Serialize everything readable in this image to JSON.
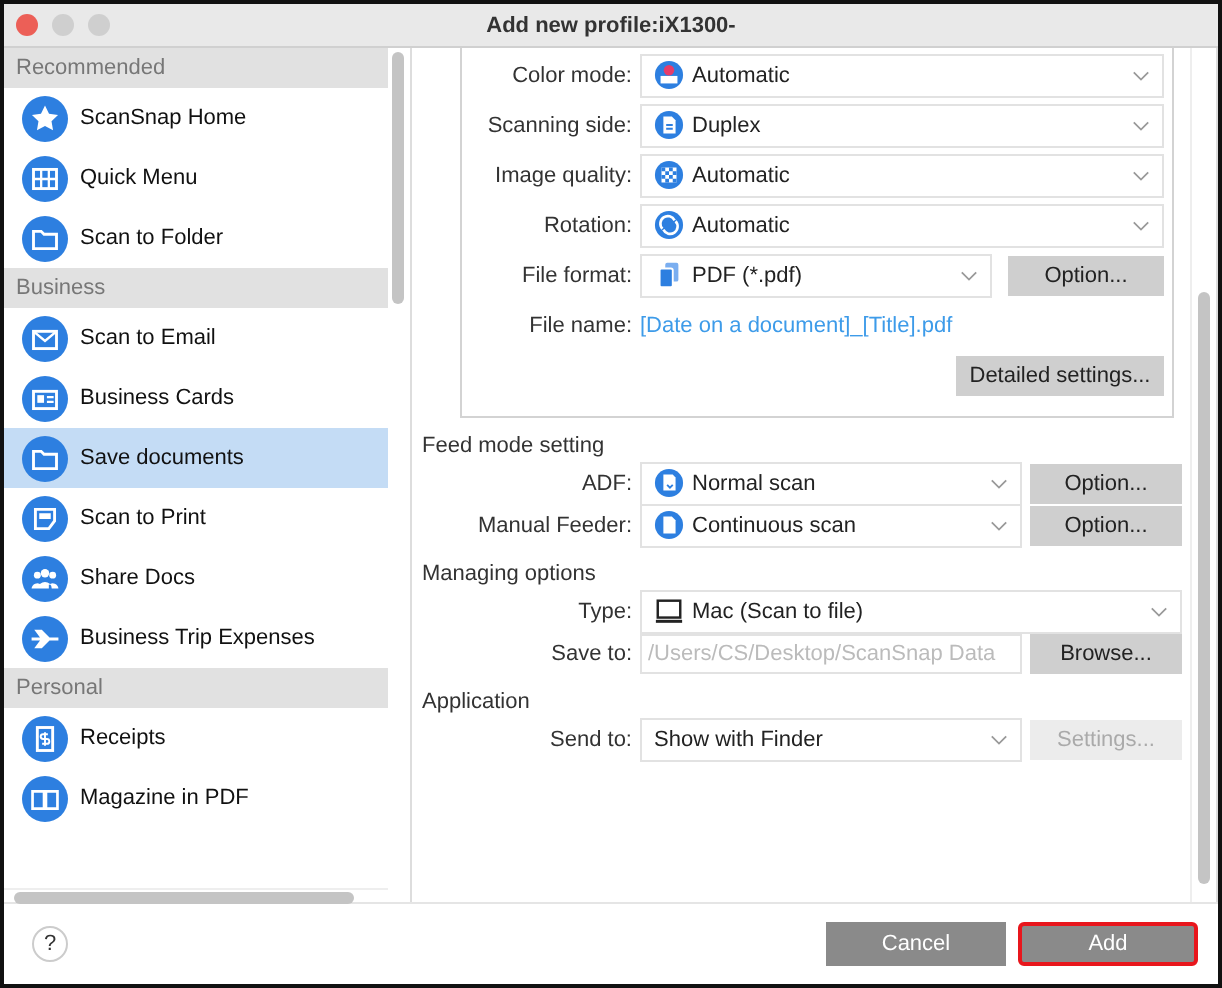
{
  "window": {
    "title": "Add new profile:iX1300-"
  },
  "sidebar": {
    "sections": [
      {
        "heading": "Recommended",
        "items": [
          {
            "label": "ScanSnap Home",
            "selected": false
          },
          {
            "label": "Quick Menu",
            "selected": false
          },
          {
            "label": "Scan to Folder",
            "selected": false
          }
        ]
      },
      {
        "heading": "Business",
        "items": [
          {
            "label": "Scan to Email",
            "selected": false
          },
          {
            "label": "Business Cards",
            "selected": false
          },
          {
            "label": "Save documents",
            "selected": true
          },
          {
            "label": "Scan to Print",
            "selected": false
          },
          {
            "label": "Share Docs",
            "selected": false
          },
          {
            "label": "Business Trip Expenses",
            "selected": false
          }
        ]
      },
      {
        "heading": "Personal",
        "items": [
          {
            "label": "Receipts",
            "selected": false
          },
          {
            "label": "Magazine in PDF",
            "selected": false
          }
        ]
      }
    ]
  },
  "settings_group": [
    {
      "kind": "select",
      "label": "Color mode:",
      "value": "Automatic"
    },
    {
      "kind": "select",
      "label": "Scanning side:",
      "value": "Duplex"
    },
    {
      "kind": "select",
      "label": "Image quality:",
      "value": "Automatic"
    },
    {
      "kind": "select",
      "label": "Rotation:",
      "value": "Automatic"
    },
    {
      "kind": "select",
      "label": "File format:",
      "value": "PDF (*.pdf)",
      "button": {
        "label": "Option...",
        "disabled": false
      }
    },
    {
      "kind": "link",
      "label": "File name:",
      "value": "[Date on a document]_[Title].pdf"
    },
    {
      "kind": "button",
      "button": {
        "label": "Detailed settings...",
        "disabled": false
      }
    }
  ],
  "sections": [
    {
      "heading": "Feed mode setting",
      "rows": [
        {
          "kind": "select",
          "label": "ADF:",
          "value": "Normal scan",
          "button": {
            "label": "Option...",
            "disabled": false
          }
        },
        {
          "kind": "select",
          "label": "Manual Feeder:",
          "value": "Continuous scan",
          "button": {
            "label": "Option...",
            "disabled": false
          }
        }
      ]
    },
    {
      "heading": "Managing options",
      "rows": [
        {
          "kind": "select",
          "label": "Type:",
          "value": "Mac (Scan to file)"
        },
        {
          "kind": "path",
          "label": "Save to:",
          "placeholder": "/Users/CS/Desktop/ScanSnap Data",
          "button": {
            "label": "Browse...",
            "disabled": false
          }
        }
      ]
    },
    {
      "heading": "Application",
      "rows": [
        {
          "kind": "select",
          "label": "Send to:",
          "value": "Show with Finder",
          "button": {
            "label": "Settings...",
            "disabled": true
          }
        }
      ]
    }
  ],
  "footer": {
    "help": "?",
    "buttons": [
      {
        "label": "Cancel",
        "highlighted": false
      },
      {
        "label": "Add",
        "highlighted": true
      }
    ]
  }
}
